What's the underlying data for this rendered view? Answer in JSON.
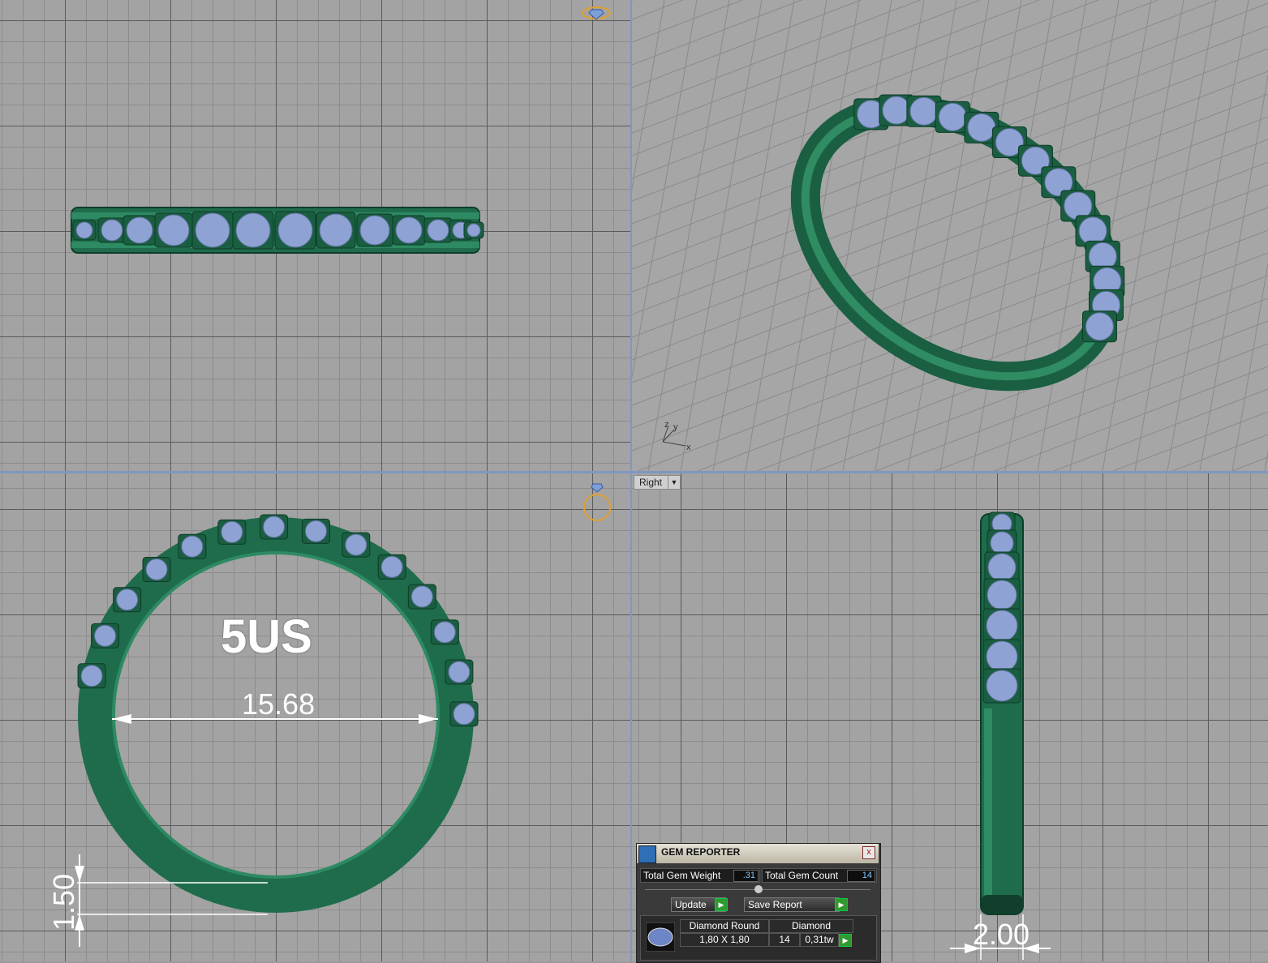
{
  "viewports": {
    "right_label": "Right"
  },
  "annotations": {
    "ring_size": "5US",
    "inner_diameter": "15.68",
    "band_thickness": "1.50",
    "band_width": "2.00"
  },
  "axis_indicator": {
    "z": "z",
    "y": "y",
    "x": "x"
  },
  "gem_reporter": {
    "title": "GEM REPORTER",
    "close": "x",
    "total_weight_label": "Total Gem Weight",
    "total_weight_value": ".31",
    "total_count_label": "Total Gem Count",
    "total_count_value": "14",
    "update_label": "Update",
    "save_label": "Save Report",
    "table": {
      "headers": [
        "Diamond Round",
        "Diamond"
      ],
      "row": {
        "size": "1,80 X 1,80",
        "count": "14",
        "tw": "0,31tw"
      }
    }
  },
  "colors": {
    "metal": "#1e6b4b",
    "gem": "#8ea3d4",
    "grid_bg": "#a3a3a3",
    "separator": "#7f97c4"
  }
}
